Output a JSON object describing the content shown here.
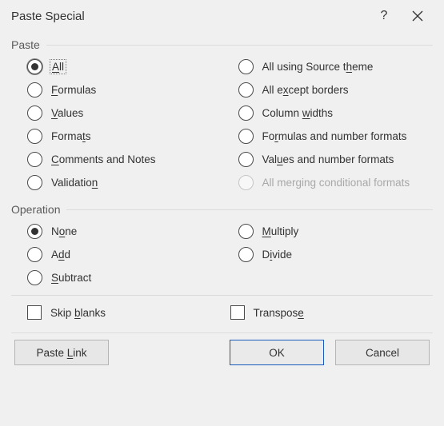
{
  "title": "Paste Special",
  "help": "?",
  "groups": {
    "paste": "Paste",
    "operation": "Operation"
  },
  "paste_left": [
    {
      "pre": "",
      "u": "A",
      "post": "ll",
      "selected": true,
      "focused": true
    },
    {
      "pre": "",
      "u": "F",
      "post": "ormulas"
    },
    {
      "pre": "",
      "u": "V",
      "post": "alues"
    },
    {
      "pre": "Forma",
      "u": "t",
      "post": "s"
    },
    {
      "pre": "",
      "u": "C",
      "post": "omments and Notes"
    },
    {
      "pre": "Validatio",
      "u": "n",
      "post": ""
    }
  ],
  "paste_right": [
    {
      "pre": "All using Source t",
      "u": "h",
      "post": "eme"
    },
    {
      "pre": "All e",
      "u": "x",
      "post": "cept borders"
    },
    {
      "pre": "Column ",
      "u": "w",
      "post": "idths"
    },
    {
      "pre": "Fo",
      "u": "r",
      "post": "mulas and number formats"
    },
    {
      "pre": "Val",
      "u": "u",
      "post": "es and number formats"
    },
    {
      "pre": "All merging conditional formats",
      "u": "",
      "post": "",
      "disabled": true
    }
  ],
  "op_left": [
    {
      "pre": "N",
      "u": "o",
      "post": "ne",
      "selected": true
    },
    {
      "pre": "A",
      "u": "d",
      "post": "d"
    },
    {
      "pre": "",
      "u": "S",
      "post": "ubtract"
    }
  ],
  "op_right": [
    {
      "pre": "",
      "u": "M",
      "post": "ultiply"
    },
    {
      "pre": "D",
      "u": "i",
      "post": "vide"
    }
  ],
  "checks_left": [
    {
      "pre": "Skip ",
      "u": "b",
      "post": "lanks"
    }
  ],
  "checks_right": [
    {
      "pre": "Transpos",
      "u": "e",
      "post": ""
    }
  ],
  "buttons": {
    "paste_link": {
      "pre": "Paste ",
      "u": "L",
      "post": "ink"
    },
    "ok": "OK",
    "cancel": "Cancel"
  }
}
